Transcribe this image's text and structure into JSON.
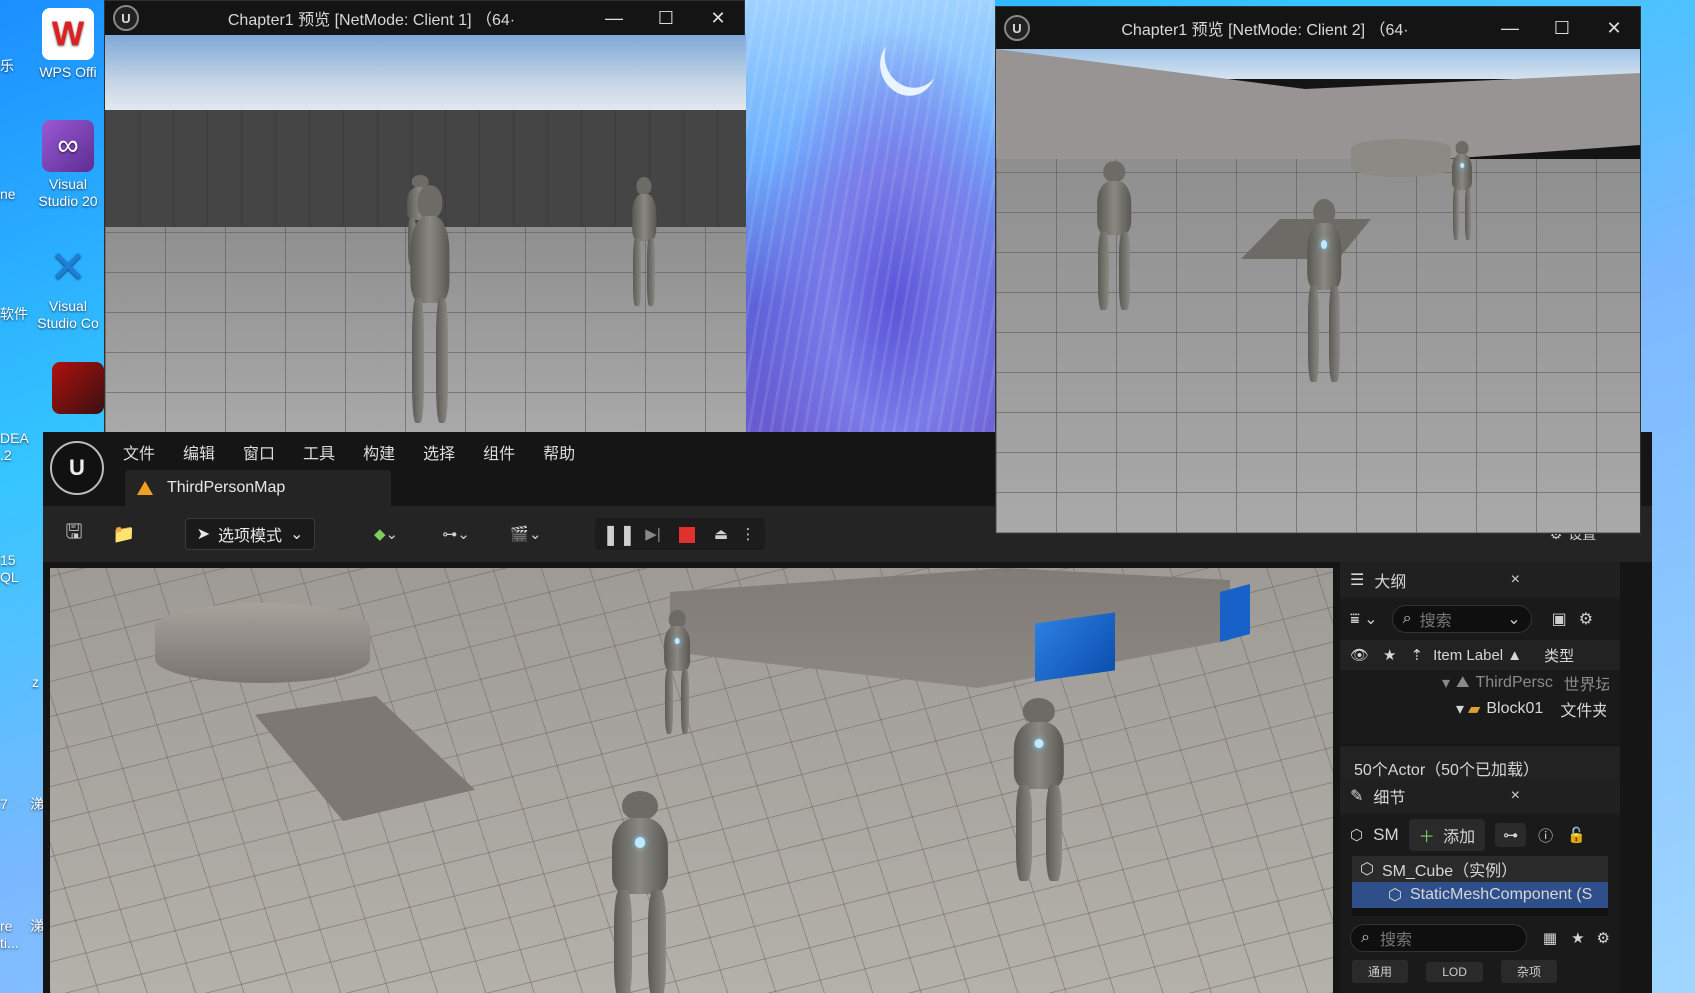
{
  "desktop": {
    "icons": [
      {
        "label": "WPS Offi",
        "name": "wps-office"
      },
      {
        "label": "Visual Studio 20",
        "name": "visual-studio-2022"
      },
      {
        "label": "Visual Studio Co",
        "name": "visual-studio-code"
      },
      {
        "label": "",
        "name": "game-launcher"
      }
    ],
    "edge_labels": [
      "乐",
      "ne",
      "软件",
      "DEA .2",
      "15 QL",
      "z",
      "7",
      "涕",
      "涕",
      "re ti..."
    ]
  },
  "client1": {
    "title": "Chapter1 预览 [NetMode: Client 1] （64·",
    "min": "—",
    "max": "☐",
    "close": "✕"
  },
  "client2": {
    "title": "Chapter1 预览 [NetMode: Client 2] （64·",
    "min": "—",
    "max": "☐",
    "close": "✕"
  },
  "editor": {
    "menu": [
      "文件",
      "编辑",
      "窗口",
      "工具",
      "构建",
      "选择",
      "组件",
      "帮助"
    ],
    "map_tab": "ThirdPersonMap",
    "mode_label": "选项模式",
    "settings_label": "设置",
    "outliner": {
      "title": "大纲",
      "close": "×",
      "search_placeholder": "搜索",
      "col_label": "Item Label ▲",
      "col_type": "类型",
      "rows": [
        {
          "label": "ThirdPersc",
          "type": "世界坛"
        },
        {
          "label": "Block01",
          "type": "文件夹"
        }
      ],
      "status": "50个Actor（50个已加载）"
    },
    "details": {
      "title": "细节",
      "close": "×",
      "sm_label": "SM",
      "add_label": "添加",
      "components": [
        {
          "label": "SM_Cube（实例）"
        },
        {
          "label": "StaticMeshComponent (S"
        }
      ],
      "search_placeholder": "搜索",
      "tabs": [
        "通用",
        "LOD",
        "杂项"
      ]
    }
  }
}
